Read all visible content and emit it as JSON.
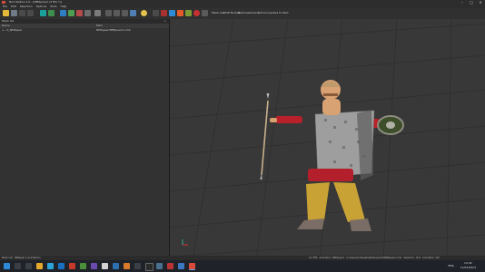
{
  "window": {
    "title": "Nod Station 4.0 - [NMSpear2 (3 File *)]",
    "minimize": "–",
    "maximize": "□",
    "close": "✕"
  },
  "menu": [
    "File",
    "Edit",
    "Selection",
    "Options",
    "Tools",
    "Help"
  ],
  "toolbar": {
    "labels": [
      "Mesh List",
      "Shift Models",
      "Textures",
      "Camera",
      "Info",
      "Connected to Mod"
    ]
  },
  "left_panel": {
    "header": "Mesh list",
    "columns": [
      "Name",
      "Path"
    ],
    "rows": [
      {
        "name": "+ - 0_NMSpear",
        "path": "NMSpear/NMSpear2.nmb"
      }
    ]
  },
  "status": {
    "left": [
      "Mesh info",
      "NMSpear 0 Animations"
    ],
    "right": "0.2 FPS  ·  Animation: NMSpear2  ·  C:/Users/UnitAssets/Meshes/Unit/NMSpear2.nmb  ·  Selection: Unit  ·  Animation: 0/0"
  },
  "taskbar": {
    "time": "14:42",
    "date": "11/03/2023",
    "lang": "ENG"
  },
  "colors": {
    "accent": "#1e7ad8",
    "viewport_bg": "#3a3a3a",
    "panel_bg": "#323232"
  }
}
